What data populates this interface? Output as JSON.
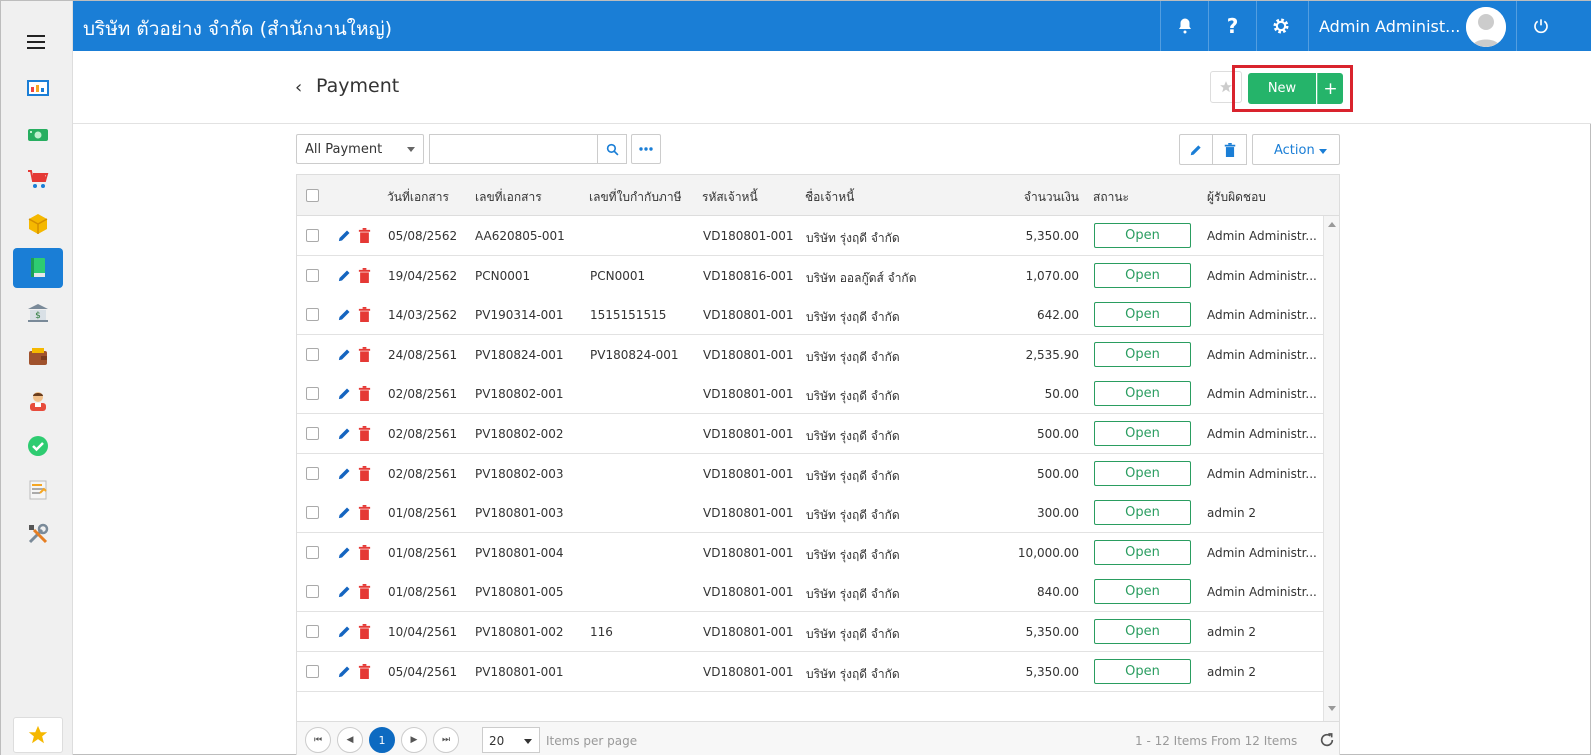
{
  "topbar": {
    "company": "บริษัท ตัวอย่าง จำกัด (สำนักงานใหญ่)",
    "user_name": "Admin Administ...",
    "icons": [
      "bell-icon",
      "help-icon",
      "gear-icon",
      "power-icon"
    ]
  },
  "sidebar": {
    "items": [
      "dashboard-icon",
      "money-icon",
      "cart-icon",
      "box-icon",
      "book-icon",
      "bank-icon",
      "wallet-icon",
      "contact-icon",
      "check-icon",
      "report-icon",
      "tools-icon"
    ],
    "active_index": 4,
    "favorite": "star-icon"
  },
  "header": {
    "title": "Payment",
    "new_label": "New",
    "new_plus": "+"
  },
  "toolbar": {
    "filter_value": "All Payment",
    "search_placeholder": "",
    "action_label": "Action"
  },
  "table": {
    "headers": [
      "วันที่เอกสาร",
      "เลขที่เอกสาร",
      "เลขที่ใบกำกับภาษี",
      "รหัสเจ้าหนี้",
      "ชื่อเจ้าหนี้",
      "จำนวนเงิน",
      "สถานะ",
      "ผู้รับผิดชอบ"
    ],
    "rows": [
      {
        "date": "05/08/2562",
        "doc": "AA620805-001",
        "tax": "",
        "vendor_code": "VD180801-001",
        "vendor_name": "บริษัท รุ่งฤดี จำกัด",
        "amount": "5,350.00",
        "status": "Open",
        "owner": "Admin Administr..."
      },
      {
        "date": "19/04/2562",
        "doc": "PCN0001",
        "tax": "PCN0001",
        "vendor_code": "VD180816-001",
        "vendor_name": "บริษัท ออลกู๊ดส์ จำกัด",
        "amount": "1,070.00",
        "status": "Open",
        "owner": "Admin Administr..."
      },
      {
        "date": "14/03/2562",
        "doc": "PV190314-001",
        "tax": "1515151515",
        "vendor_code": "VD180801-001",
        "vendor_name": "บริษัท รุ่งฤดี จำกัด",
        "amount": "642.00",
        "status": "Open",
        "owner": "Admin Administr..."
      },
      {
        "date": "24/08/2561",
        "doc": "PV180824-001",
        "tax": "PV180824-001",
        "vendor_code": "VD180801-001",
        "vendor_name": "บริษัท รุ่งฤดี จำกัด",
        "amount": "2,535.90",
        "status": "Open",
        "owner": "Admin Administr..."
      },
      {
        "date": "02/08/2561",
        "doc": "PV180802-001",
        "tax": "",
        "vendor_code": "VD180801-001",
        "vendor_name": "บริษัท รุ่งฤดี จำกัด",
        "amount": "50.00",
        "status": "Open",
        "owner": "Admin Administr..."
      },
      {
        "date": "02/08/2561",
        "doc": "PV180802-002",
        "tax": "",
        "vendor_code": "VD180801-001",
        "vendor_name": "บริษัท รุ่งฤดี จำกัด",
        "amount": "500.00",
        "status": "Open",
        "owner": "Admin Administr..."
      },
      {
        "date": "02/08/2561",
        "doc": "PV180802-003",
        "tax": "",
        "vendor_code": "VD180801-001",
        "vendor_name": "บริษัท รุ่งฤดี จำกัด",
        "amount": "500.00",
        "status": "Open",
        "owner": "Admin Administr..."
      },
      {
        "date": "01/08/2561",
        "doc": "PV180801-003",
        "tax": "",
        "vendor_code": "VD180801-001",
        "vendor_name": "บริษัท รุ่งฤดี จำกัด",
        "amount": "300.00",
        "status": "Open",
        "owner": "admin 2"
      },
      {
        "date": "01/08/2561",
        "doc": "PV180801-004",
        "tax": "",
        "vendor_code": "VD180801-001",
        "vendor_name": "บริษัท รุ่งฤดี จำกัด",
        "amount": "10,000.00",
        "status": "Open",
        "owner": "Admin Administr..."
      },
      {
        "date": "01/08/2561",
        "doc": "PV180801-005",
        "tax": "",
        "vendor_code": "VD180801-001",
        "vendor_name": "บริษัท รุ่งฤดี จำกัด",
        "amount": "840.00",
        "status": "Open",
        "owner": "Admin Administr..."
      },
      {
        "date": "10/04/2561",
        "doc": "PV180801-002",
        "tax": "116",
        "vendor_code": "VD180801-001",
        "vendor_name": "บริษัท รุ่งฤดี จำกัด",
        "amount": "5,350.00",
        "status": "Open",
        "owner": "admin 2"
      },
      {
        "date": "05/04/2561",
        "doc": "PV180801-001",
        "tax": "",
        "vendor_code": "VD180801-001",
        "vendor_name": "บริษัท รุ่งฤดี จำกัด",
        "amount": "5,350.00",
        "status": "Open",
        "owner": "admin 2"
      }
    ]
  },
  "pager": {
    "first": "⏮",
    "prev": "◀",
    "current_page": "1",
    "next": "▶",
    "last": "⏭",
    "page_size": "20",
    "items_per_page": "Items per page",
    "info": "1 - 12 Items From 12 Items"
  },
  "colors": {
    "primary": "#1a7ed6",
    "success": "#25b46a",
    "highlight": "#d9232d",
    "status": "#2a9d60"
  }
}
